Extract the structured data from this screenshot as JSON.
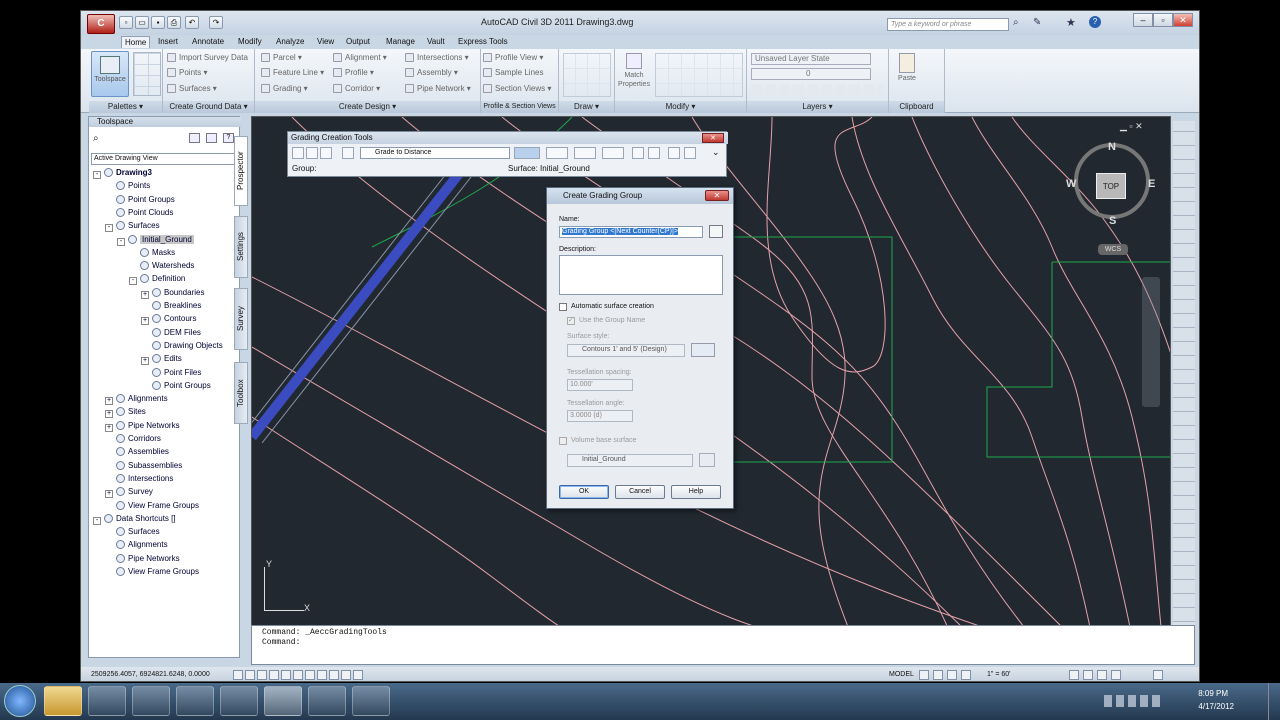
{
  "window": {
    "title": "AutoCAD Civil 3D 2011    Drawing3.dwg",
    "search_placeholder": "Type a keyword or phrase"
  },
  "menu_tabs": [
    "Home",
    "Insert",
    "Annotate",
    "Modify",
    "Analyze",
    "View",
    "Output",
    "Manage",
    "Vault",
    "Express Tools"
  ],
  "ribbon": {
    "palettes": {
      "toolspace": "Toolspace",
      "title": "Palettes ▾"
    },
    "ground": {
      "items": [
        "Import Survey Data",
        "Points ▾",
        "Surfaces ▾"
      ],
      "title": "Create Ground Data ▾"
    },
    "design": {
      "col1": [
        "Parcel ▾",
        "Feature Line ▾",
        "Grading ▾"
      ],
      "col2": [
        "Alignment ▾",
        "Profile ▾",
        "Corridor ▾"
      ],
      "col3": [
        "Intersections ▾",
        "Assembly ▾",
        "Pipe Network ▾"
      ],
      "title": "Create Design ▾"
    },
    "profile": {
      "items": [
        "Profile View ▾",
        "Sample Lines",
        "Section Views ▾"
      ],
      "title": "Profile & Section Views"
    },
    "draw_title": "Draw ▾",
    "modify": {
      "match": "Match Properties",
      "title": "Modify ▾"
    },
    "layers": {
      "state": "Unsaved Layer State",
      "layer": "0",
      "title": "Layers ▾"
    },
    "clipboard": {
      "paste": "Paste",
      "title": "Clipboard"
    }
  },
  "toolspace": {
    "header": "Toolspace",
    "filter": "Active Drawing View",
    "tabs": [
      "Prospector",
      "Settings",
      "Survey",
      "Toolbox"
    ],
    "tree": [
      {
        "t": "Drawing3",
        "d": 0,
        "e": "-",
        "b": true
      },
      {
        "t": "Points",
        "d": 1,
        "e": ""
      },
      {
        "t": "Point Groups",
        "d": 1,
        "e": ""
      },
      {
        "t": "Point Clouds",
        "d": 1,
        "e": ""
      },
      {
        "t": "Surfaces",
        "d": 1,
        "e": "-"
      },
      {
        "t": "Initial_Ground",
        "d": 2,
        "e": "-",
        "sel": true
      },
      {
        "t": "Masks",
        "d": 3,
        "e": ""
      },
      {
        "t": "Watersheds",
        "d": 3,
        "e": ""
      },
      {
        "t": "Definition",
        "d": 3,
        "e": "-"
      },
      {
        "t": "Boundaries",
        "d": 4,
        "e": "+"
      },
      {
        "t": "Breaklines",
        "d": 4,
        "e": ""
      },
      {
        "t": "Contours",
        "d": 4,
        "e": "+"
      },
      {
        "t": "DEM Files",
        "d": 4,
        "e": ""
      },
      {
        "t": "Drawing Objects",
        "d": 4,
        "e": ""
      },
      {
        "t": "Edits",
        "d": 4,
        "e": "+"
      },
      {
        "t": "Point Files",
        "d": 4,
        "e": ""
      },
      {
        "t": "Point Groups",
        "d": 4,
        "e": ""
      },
      {
        "t": "Alignments",
        "d": 1,
        "e": "+"
      },
      {
        "t": "Sites",
        "d": 1,
        "e": "+"
      },
      {
        "t": "Pipe Networks",
        "d": 1,
        "e": "+"
      },
      {
        "t": "Corridors",
        "d": 1,
        "e": ""
      },
      {
        "t": "Assemblies",
        "d": 1,
        "e": ""
      },
      {
        "t": "Subassemblies",
        "d": 1,
        "e": ""
      },
      {
        "t": "Intersections",
        "d": 1,
        "e": ""
      },
      {
        "t": "Survey",
        "d": 1,
        "e": "+"
      },
      {
        "t": "View Frame Groups",
        "d": 1,
        "e": ""
      },
      {
        "t": "Data Shortcuts []",
        "d": 0,
        "e": "-"
      },
      {
        "t": "Surfaces",
        "d": 1,
        "e": ""
      },
      {
        "t": "Alignments",
        "d": 1,
        "e": ""
      },
      {
        "t": "Pipe Networks",
        "d": 1,
        "e": ""
      },
      {
        "t": "View Frame Groups",
        "d": 1,
        "e": ""
      }
    ]
  },
  "grading_tools": {
    "title": "Grading Creation Tools",
    "criteria": "Grade to Distance",
    "group_label": "Group:",
    "surface_label": "Surface: Initial_Ground"
  },
  "dialog": {
    "title": "Create Grading Group",
    "name_label": "Name:",
    "name_value": "Grading Group <[Next Counter(CP)]>",
    "description_label": "Description:",
    "auto_surface": "Automatic surface creation",
    "use_group_name": "Use the Group Name",
    "surface_style_label": "Surface style:",
    "surface_style": "Contours 1' and 5' (Design)",
    "tess_spacing_label": "Tessellation spacing:",
    "tess_spacing": "10.000'",
    "tess_angle_label": "Tessellation angle:",
    "tess_angle": "3.0000 (d)",
    "volume_base": "Volume base surface",
    "base_surface": "Initial_Ground",
    "ok": "OK",
    "cancel": "Cancel",
    "help": "Help"
  },
  "compass": {
    "n": "N",
    "s": "S",
    "e": "E",
    "w": "W",
    "top": "TOP",
    "wcs": "WCS"
  },
  "ucs": {
    "x": "X",
    "y": "Y"
  },
  "command": {
    "line1": "Command: _AeccGradingTools",
    "line2": "Command:"
  },
  "status": {
    "coords": "2509256.4057, 6924821.6248, 0.0000",
    "model": "MODEL",
    "scale": "1\" = 60'"
  },
  "taskbar": {
    "time": "8:09 PM",
    "date": "4/17/2012"
  },
  "colors": {
    "drawing_bg": "#212830",
    "contour": "#e6a0a8",
    "boundary": "#1ea84a",
    "road": "#3a4cc0"
  }
}
